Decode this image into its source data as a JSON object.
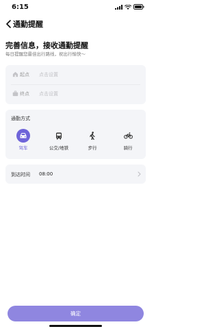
{
  "status_bar": {
    "time": "6:15",
    "icons": [
      "signal-icon",
      "wifi-icon",
      "battery-icon"
    ]
  },
  "nav": {
    "back_icon": "chevron-left-icon",
    "title": "通勤提醒"
  },
  "intro": {
    "heading": "完善信息，接收通勤提醒",
    "subheading": "每日提醒您最佳出行路线，祝出行愉快～"
  },
  "route": {
    "start": {
      "icon": "home-icon",
      "label": "起点",
      "placeholder": "点击设置"
    },
    "end": {
      "icon": "briefcase-icon",
      "label": "终点",
      "placeholder": "点击设置"
    }
  },
  "commute_mode": {
    "title": "通勤方式",
    "selected": "驾车",
    "options": [
      {
        "icon": "car-icon",
        "label": "驾车",
        "active": true
      },
      {
        "icon": "bus-icon",
        "label": "公交/地铁",
        "active": false
      },
      {
        "icon": "walk-icon",
        "label": "步行",
        "active": false
      },
      {
        "icon": "bike-icon",
        "label": "骑行",
        "active": false
      }
    ]
  },
  "arrival": {
    "label": "到达时间",
    "value": "08:00",
    "chevron_icon": "chevron-right-icon"
  },
  "confirm_label": "确定",
  "colors": {
    "accent": "#6e64d9",
    "button": "#8f86e0",
    "card": "#f4f5f8",
    "placeholder": "#c2c2c6"
  }
}
